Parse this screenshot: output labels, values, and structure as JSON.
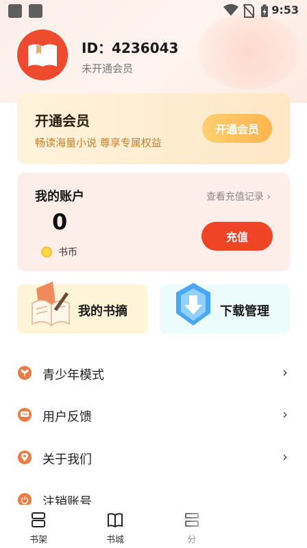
{
  "status_bar": {
    "time": "9:53",
    "icons": [
      "wifi-icon",
      "no-sim-icon",
      "battery-charging-icon"
    ]
  },
  "profile": {
    "id_text": "ID：4236043",
    "member_status": "未开通会员",
    "avatar_icon": "open-book-icon"
  },
  "vip_card": {
    "title": "开通会员",
    "subtitle": "畅读海量小说 尊享专属权益",
    "button_label": "开通会员"
  },
  "account": {
    "title": "我的账户",
    "record_link": "查看充值记录",
    "balance": "0",
    "coin_label": "书币",
    "recharge_label": "充值"
  },
  "tiles": [
    {
      "label": "我的书摘",
      "icon": "book-notes-icon"
    },
    {
      "label": "下载管理",
      "icon": "download-shield-icon"
    }
  ],
  "menu": [
    {
      "label": "青少年模式",
      "icon": "sprout-icon"
    },
    {
      "label": "用户反馈",
      "icon": "chat-bubble-icon"
    },
    {
      "label": "关于我们",
      "icon": "location-pin-icon"
    },
    {
      "label": "注销账号",
      "icon": "power-icon"
    }
  ],
  "bottom_nav": [
    {
      "label": "书架",
      "icon": "bookshelf-icon"
    },
    {
      "label": "书城",
      "icon": "bookstore-icon"
    },
    {
      "label": "分",
      "icon": "category-icon"
    }
  ],
  "colors": {
    "accent_red": "#ef4526",
    "vip_gold": "#ffb44d",
    "avatar_bg": "#ee4a2d"
  }
}
